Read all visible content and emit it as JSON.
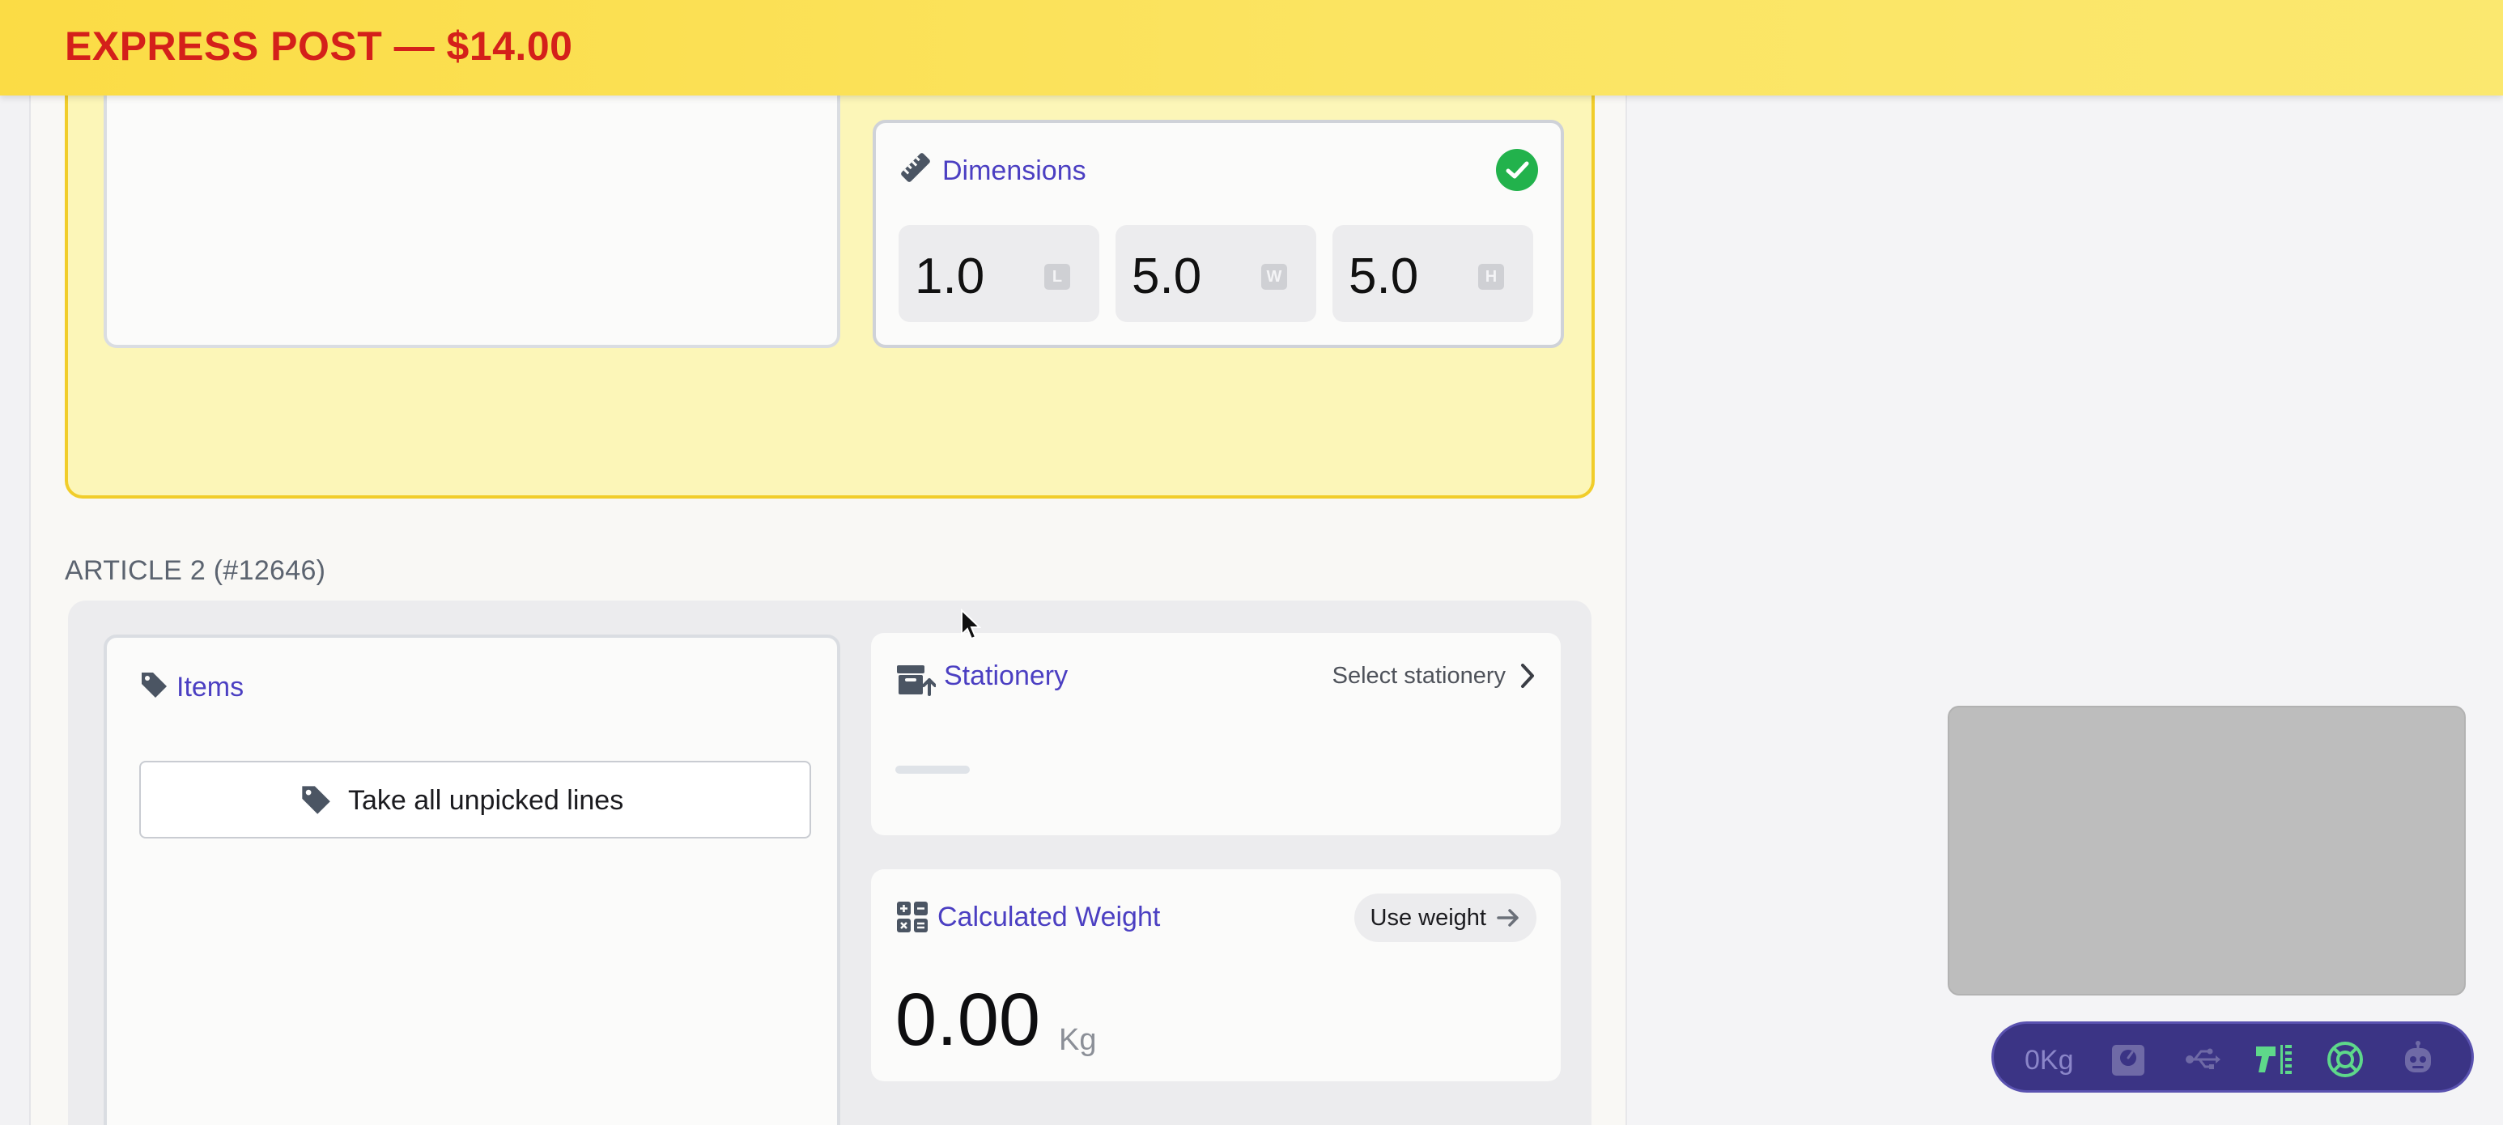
{
  "header": {
    "title": "EXPRESS POST — $14.00"
  },
  "article1": {
    "dimensions": {
      "title": "Dimensions",
      "status": "complete",
      "fields": [
        {
          "value": "1.0",
          "badge": "L"
        },
        {
          "value": "5.0",
          "badge": "W"
        },
        {
          "value": "5.0",
          "badge": "H"
        }
      ]
    }
  },
  "article2": {
    "label": "ARTICLE 2 (#12646)",
    "items": {
      "title": "Items",
      "take_all_label": "Take all unpicked lines"
    },
    "stationery": {
      "title": "Stationery",
      "select_label": "Select stationery"
    },
    "calculated_weight": {
      "title": "Calculated Weight",
      "use_weight_label": "Use weight",
      "value": "0.00",
      "unit": "Kg"
    }
  },
  "device_bar": {
    "scale_reading": "0Kg"
  },
  "colors": {
    "header_bg": "#fbdc45",
    "header_text": "#d4201a",
    "accent": "#4b3fc2",
    "success": "#22b24c",
    "device_bar_bg": "#3b3485",
    "device_active": "#5ed88a"
  }
}
